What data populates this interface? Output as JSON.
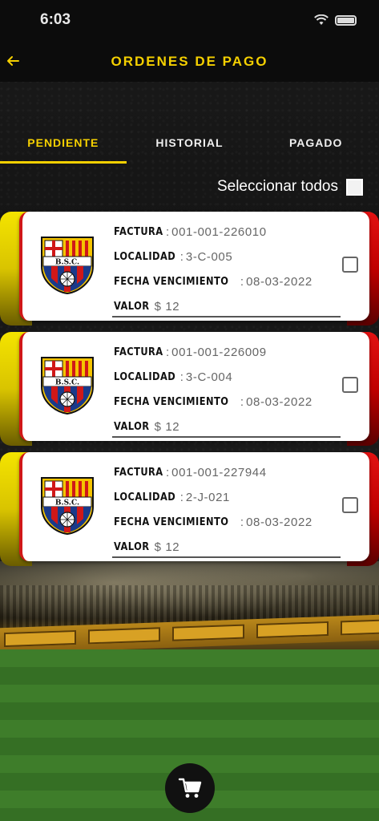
{
  "status_bar": {
    "time": "6:03"
  },
  "header": {
    "title": "ORDENES DE PAGO"
  },
  "tabs": [
    {
      "label": "PENDIENTE",
      "active": true
    },
    {
      "label": "HISTORIAL",
      "active": false
    },
    {
      "label": "PAGADO",
      "active": false
    }
  ],
  "select_all": {
    "label": "Seleccionar todos"
  },
  "labels": {
    "factura": "FACTURA",
    "localidad": "LOCALIDAD",
    "fecha_vencimiento": "FECHA VENCIMIENTO",
    "valor": "VALOR"
  },
  "orders": [
    {
      "crest_text": "B.S.C.",
      "factura": "001-001-226010",
      "localidad": "3-C-005",
      "fecha_vencimiento": "08-03-2022",
      "valor": "$ 12"
    },
    {
      "crest_text": "B.S.C.",
      "factura": "001-001-226009",
      "localidad": "3-C-004",
      "fecha_vencimiento": "08-03-2022",
      "valor": "$ 12"
    },
    {
      "crest_text": "B.S.C.",
      "factura": "001-001-227944",
      "localidad": "2-J-021",
      "fecha_vencimiento": "08-03-2022",
      "valor": "$ 12"
    }
  ],
  "colors": {
    "accent_yellow": "#f5d000",
    "club_red": "#d01818",
    "background": "#151515"
  },
  "icons": {
    "back": "arrow-left-icon",
    "cart": "shopping-cart-icon",
    "wifi": "wifi-icon",
    "battery": "battery-icon"
  }
}
